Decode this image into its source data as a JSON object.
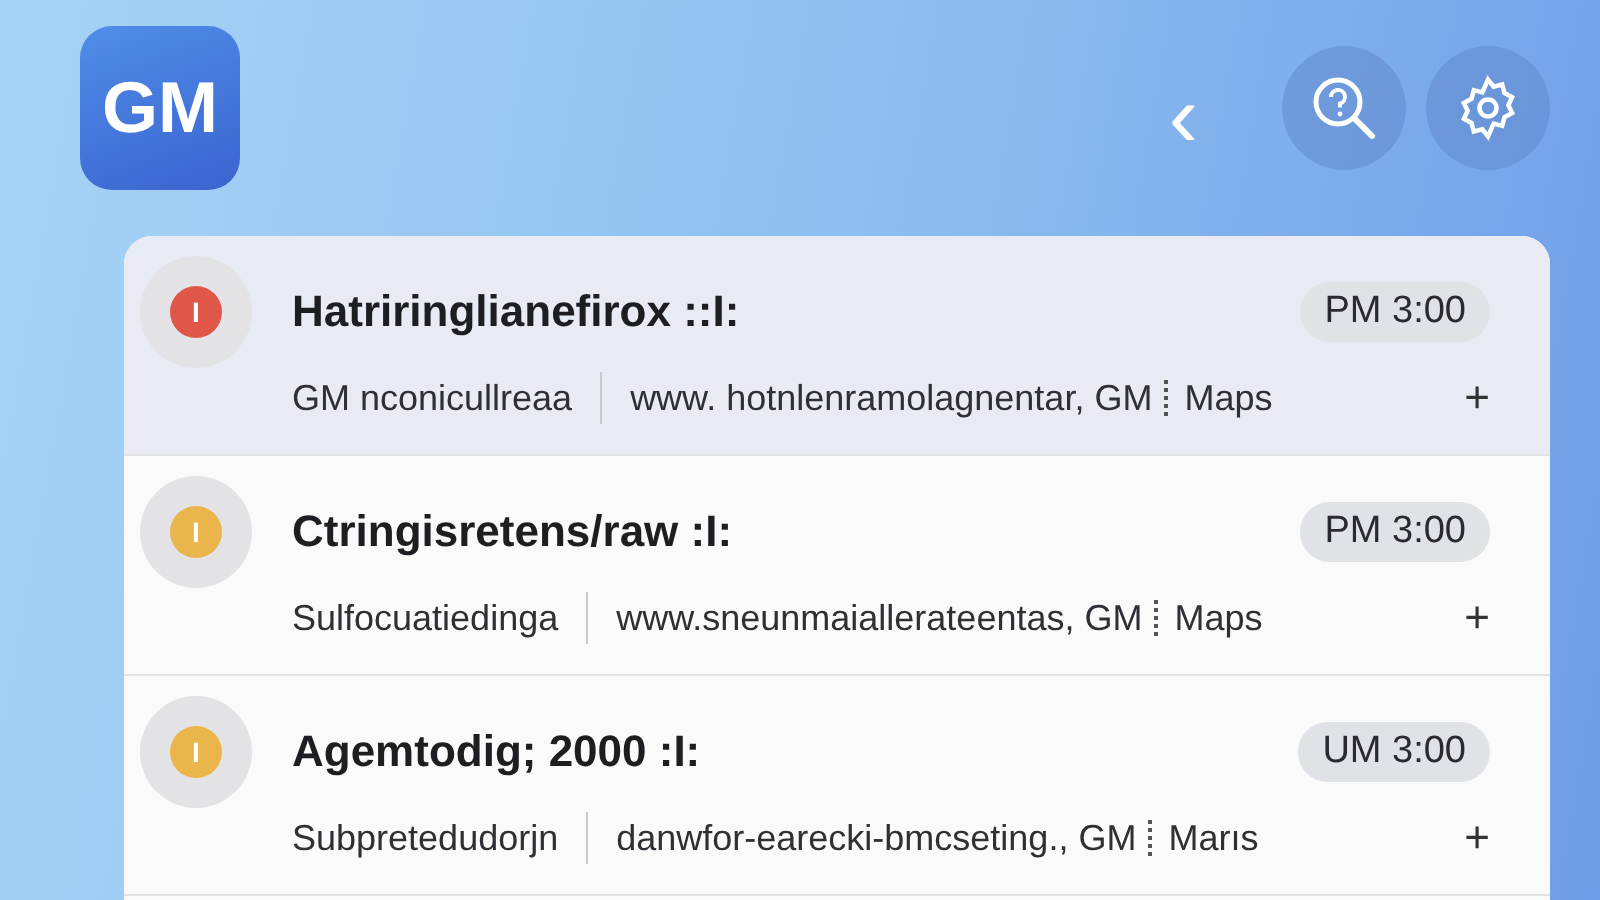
{
  "header": {
    "logo": "GM",
    "back": "‹"
  },
  "messages": [
    {
      "title": "Hatriringlianefirox ::I:",
      "time": "PM 3:00",
      "sender": "GM nconicullreaa",
      "url": "www. hotnlenramolagnentar, GM",
      "service": "Maps",
      "action": "+",
      "badge": "I",
      "color": "#e0574a",
      "selected": true
    },
    {
      "title": "Ctringisretens/raw :I:",
      "time": "PM 3:00",
      "sender": "Sulfocuatiedinga",
      "url": "www.sneunmaiallerateentas, GM",
      "service": "Maps",
      "action": "+",
      "badge": "I",
      "color": "#eab54a",
      "selected": false
    },
    {
      "title": "Agemtodig; 2000 :I:",
      "time": "UM 3:00",
      "sender": "Subpretedudorjn",
      "url": "danwfor-earecki-bmcseting., GM",
      "service": "Marıs",
      "action": "+",
      "badge": "I",
      "color": "#eab54a",
      "selected": false
    }
  ]
}
